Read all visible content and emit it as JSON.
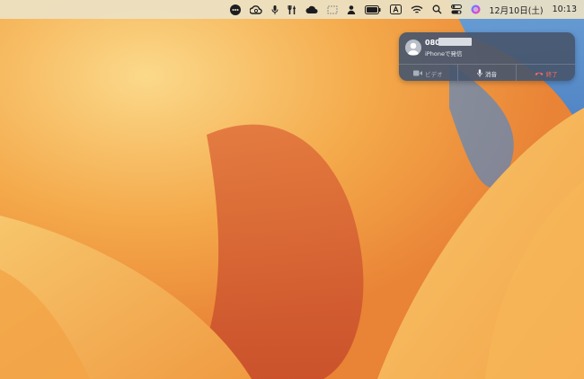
{
  "menubar": {
    "date": "12月10日(土)",
    "time": "10:13",
    "icons": [
      "more-icon",
      "creative-cloud-icon",
      "microphone-icon",
      "tools-icon",
      "cloud-icon",
      "dropbox-icon",
      "user-icon",
      "battery-icon",
      "input-source-a-icon",
      "wifi-icon",
      "spotlight-search-icon",
      "control-center-icon",
      "siri-icon"
    ]
  },
  "notification": {
    "caller": "080",
    "subtitle": "iPhoneで発信",
    "actions": {
      "video": "ビデオ",
      "mute": "消音",
      "end": "終了"
    }
  }
}
